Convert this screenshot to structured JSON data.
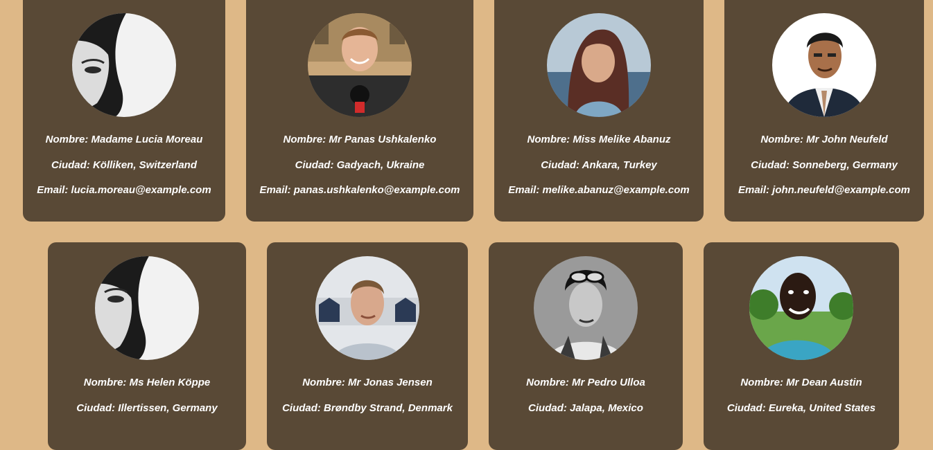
{
  "colors": {
    "background": "#DEB887",
    "card": "#594936",
    "text": "#FFFFFF"
  },
  "users": [
    {
      "name_text": "Nombre: Madame Lucia Moreau",
      "city_text": "Ciudad: Kölliken, Switzerland",
      "email_text": "Email: lucia.moreau@example.com",
      "photo": "woman-half-face-bw-photo"
    },
    {
      "name_text": "Nombre: Mr Panas Ushkalenko",
      "city_text": "Ciudad: Gadyach, Ukraine",
      "email_text": "Email: panas.ushkalenko@example.com",
      "photo": "smiling-man-with-microphone-photo"
    },
    {
      "name_text": "Nombre: Miss Melike Abanuz",
      "city_text": "Ciudad: Ankara, Turkey",
      "email_text": "Email: melike.abanuz@example.com",
      "photo": "woman-by-sea-photo"
    },
    {
      "name_text": "Nombre: Mr John Neufeld",
      "city_text": "Ciudad: Sonneberg, Germany",
      "email_text": "Email: john.neufeld@example.com",
      "photo": "man-in-suit-photo"
    },
    {
      "name_text": "Nombre: Ms Helen Köppe",
      "city_text": "Ciudad: Illertissen, Germany",
      "email_text": "",
      "photo": "woman-half-face-bw-photo"
    },
    {
      "name_text": "Nombre: Mr Jonas Jensen",
      "city_text": "Ciudad: Brøndby Strand, Denmark",
      "email_text": "",
      "photo": "young-man-beach-huts-photo"
    },
    {
      "name_text": "Nombre: Mr Pedro Ulloa",
      "city_text": "Ciudad: Jalapa, Mexico",
      "email_text": "",
      "photo": "man-with-sunglasses-bw-photo"
    },
    {
      "name_text": "Nombre: Mr Dean Austin",
      "city_text": "Ciudad: Eureka, United States",
      "email_text": "",
      "photo": "smiling-man-park-photo"
    }
  ]
}
